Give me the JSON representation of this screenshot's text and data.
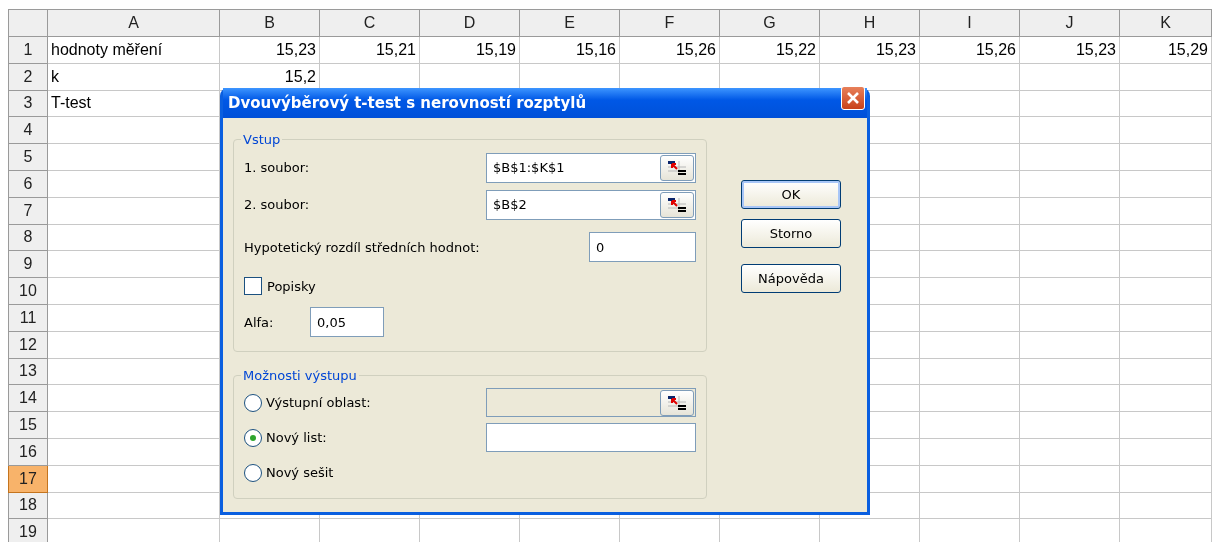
{
  "sheet": {
    "columns": [
      "A",
      "B",
      "C",
      "D",
      "E",
      "F",
      "G",
      "H",
      "I",
      "J",
      "K"
    ],
    "rows": [
      {
        "header": "1",
        "selected": false,
        "cells": [
          "hodnoty měření",
          "15,23",
          "15,21",
          "15,19",
          "15,16",
          "15,26",
          "15,22",
          "15,23",
          "15,26",
          "15,23",
          "15,29"
        ]
      },
      {
        "header": "2",
        "selected": false,
        "cells": [
          "k",
          "15,2"
        ]
      },
      {
        "header": "3",
        "selected": false,
        "cells": [
          "T-test"
        ]
      },
      {
        "header": "4",
        "selected": false
      },
      {
        "header": "5",
        "selected": false
      },
      {
        "header": "6",
        "selected": false
      },
      {
        "header": "7",
        "selected": false
      },
      {
        "header": "8",
        "selected": false
      },
      {
        "header": "9",
        "selected": false
      },
      {
        "header": "10",
        "selected": false
      },
      {
        "header": "11",
        "selected": false
      },
      {
        "header": "12",
        "selected": false
      },
      {
        "header": "13",
        "selected": false
      },
      {
        "header": "14",
        "selected": false
      },
      {
        "header": "15",
        "selected": false
      },
      {
        "header": "16",
        "selected": false
      },
      {
        "header": "17",
        "selected": true
      },
      {
        "header": "18",
        "selected": false
      },
      {
        "header": "19",
        "selected": false
      }
    ]
  },
  "dialog": {
    "title": "Dvouvýběrový t-test s nerovností rozptylů",
    "input_group": {
      "legend": "Vstup",
      "range_1": {
        "label": "1. soubor:",
        "value": "$B$1:$K$1"
      },
      "range_2": {
        "label": "2. soubor:",
        "value": "$B$2"
      },
      "difference": {
        "label": "Hypotetický rozdíl středních hodnot:",
        "value": "0"
      },
      "labels_checkbox": {
        "label": "Popisky",
        "checked": false
      },
      "alpha": {
        "label": "Alfa:",
        "value": "0,05"
      }
    },
    "output_group": {
      "legend": "Možnosti výstupu",
      "options": [
        {
          "label": "Výstupní oblast:",
          "selected": false,
          "kind": "range",
          "field_disabled": true
        },
        {
          "label": "Nový list:",
          "selected": true,
          "kind": "text",
          "field_disabled": false
        },
        {
          "label": "Nový sešit",
          "selected": false,
          "kind": "none"
        }
      ]
    },
    "buttons": [
      {
        "label": "OK",
        "default": true
      },
      {
        "label": "Storno",
        "default": false
      },
      {
        "label": "Nápověda",
        "default": false
      }
    ]
  }
}
